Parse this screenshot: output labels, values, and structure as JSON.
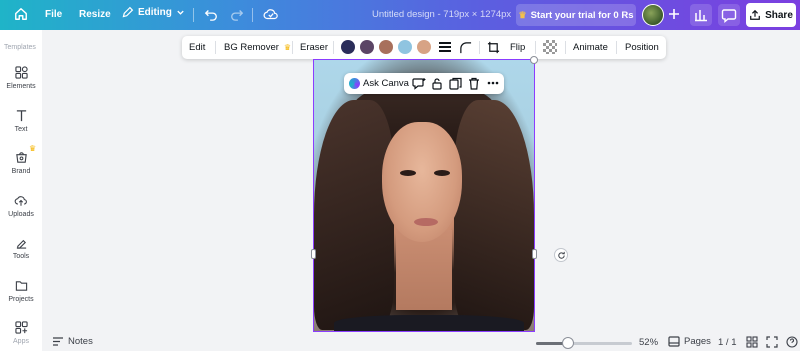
{
  "topbar": {
    "home_icon": "home-icon",
    "file_label": "File",
    "resize_label": "Resize",
    "editing_label": "Editing",
    "document_title": "Untitled design - 719px × 1274px",
    "trial_label": "Start your trial for 0 Rs",
    "share_label": "Share"
  },
  "sidebar": {
    "heading": "Templates",
    "items": [
      {
        "label": "Elements",
        "icon": "elements-icon"
      },
      {
        "label": "Text",
        "icon": "text-icon"
      },
      {
        "label": "Brand",
        "icon": "brand-icon"
      },
      {
        "label": "Uploads",
        "icon": "uploads-icon"
      },
      {
        "label": "Tools",
        "icon": "tools-icon"
      },
      {
        "label": "Projects",
        "icon": "projects-icon"
      },
      {
        "label": "Apps",
        "icon": "apps-icon"
      }
    ]
  },
  "context_toolbar": {
    "edit_label": "Edit",
    "bg_remover_label": "BG Remover",
    "eraser_label": "Eraser",
    "swatches": [
      "#2b2d5a",
      "#5b4565",
      "#a8705c",
      "#8fc4e0",
      "#d7a385"
    ],
    "flip_label": "Flip",
    "animate_label": "Animate",
    "position_label": "Position"
  },
  "floating_toolbar": {
    "ask_label": "Ask Canva"
  },
  "bottombar": {
    "notes_label": "Notes",
    "zoom_value": 52,
    "zoom_label": "52%",
    "pages_label": "Pages",
    "page_count": "1 / 1"
  },
  "colors": {
    "accent": "#8b3dff",
    "crown": "#f5b400"
  }
}
